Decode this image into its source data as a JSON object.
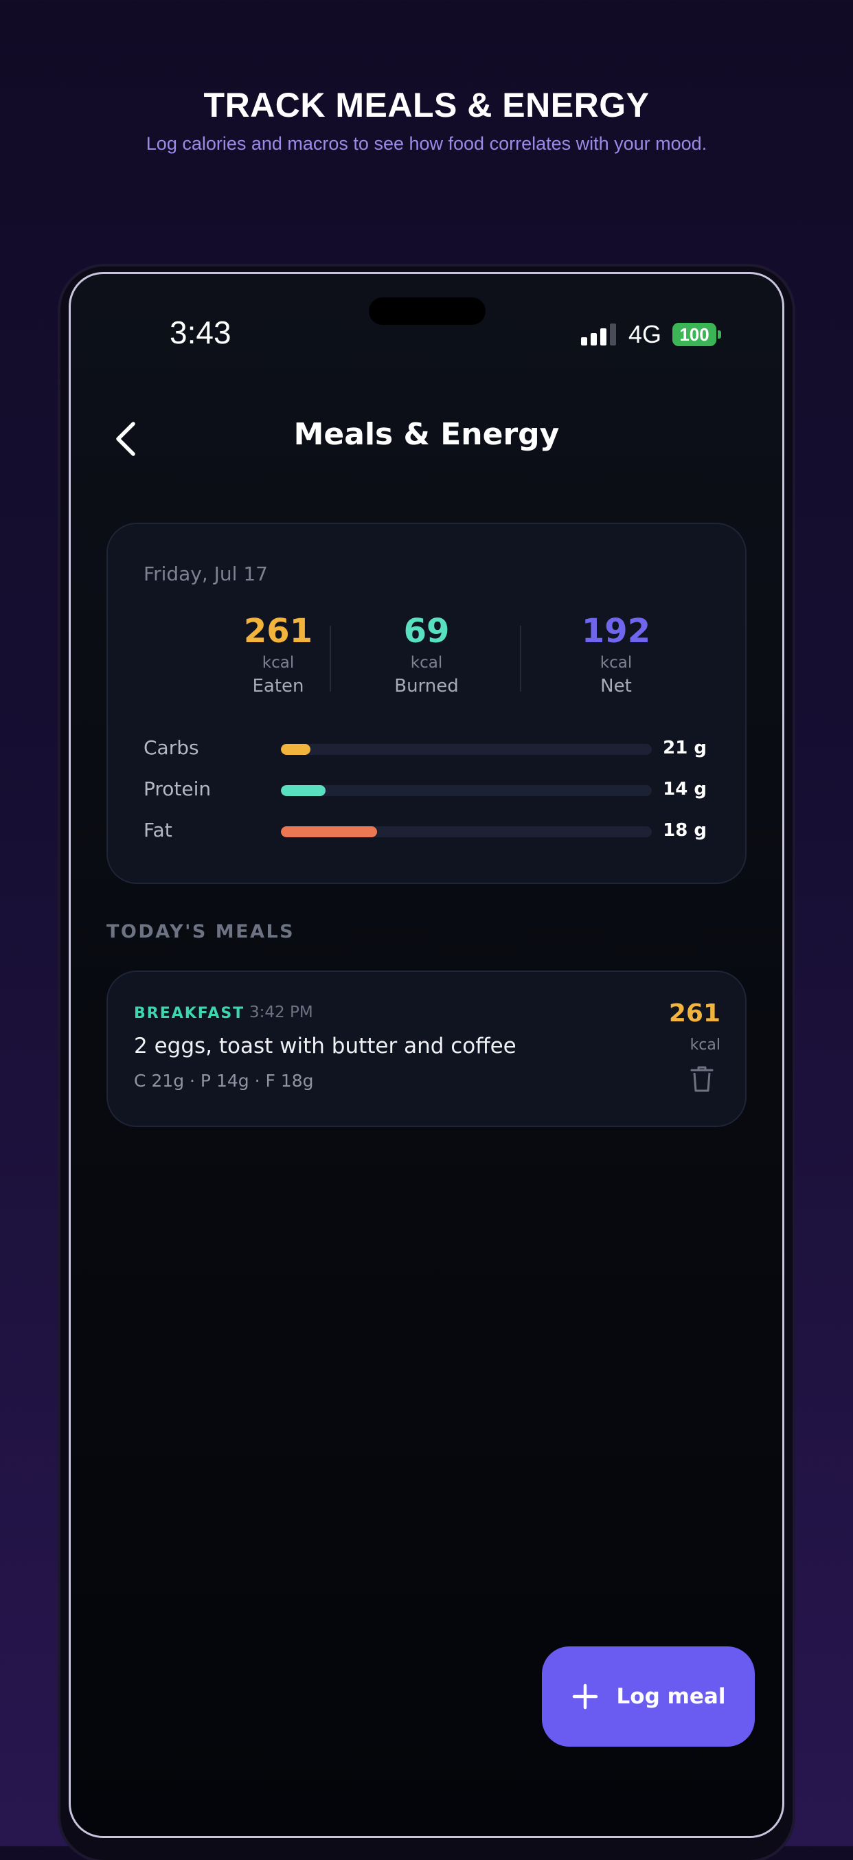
{
  "promo": {
    "title": "TRACK MEALS & ENERGY",
    "subtitle": "Log calories and macros to see how food correlates with your mood."
  },
  "status_bar": {
    "time": "3:43",
    "network": "4G",
    "battery": "100"
  },
  "header": {
    "back_icon": "chevron-left-icon",
    "title": "Meals & Energy"
  },
  "summary": {
    "date": "Friday, Jul 17",
    "stats": [
      {
        "value": "261",
        "unit": "kcal",
        "label": "Eaten",
        "color": "#f2b43c"
      },
      {
        "value": "69",
        "unit": "kcal",
        "label": "Burned",
        "color": "#58e0c0"
      },
      {
        "value": "192",
        "unit": "kcal",
        "label": "Net",
        "color": "#7066ee"
      }
    ],
    "macros": [
      {
        "label": "Carbs",
        "value": "21 g",
        "fill_fraction": 0.08,
        "color": "#f2b43c"
      },
      {
        "label": "Protein",
        "value": "14 g",
        "fill_fraction": 0.12,
        "color": "#58e0c0"
      },
      {
        "label": "Fat",
        "value": "18 g",
        "fill_fraction": 0.26,
        "color": "#eb7852"
      }
    ]
  },
  "meals_section": {
    "title": "TODAY'S MEALS",
    "meals": [
      {
        "type": "BREAKFAST",
        "time": "3:42 PM",
        "description": "2 eggs, toast with butter and coffee",
        "macros": "C 21g · P 14g · F 18g",
        "kcal": "261",
        "kcal_unit": "kcal",
        "delete_icon": "trash-icon"
      }
    ]
  },
  "fab": {
    "label": "Log meal",
    "icon": "plus-icon"
  }
}
